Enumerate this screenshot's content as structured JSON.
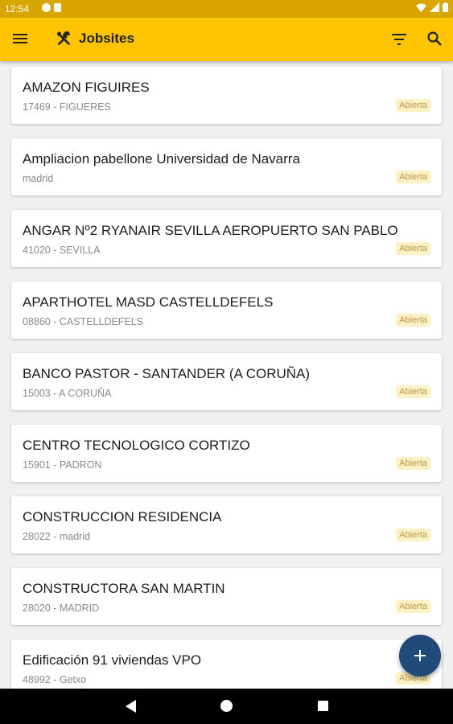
{
  "status_bar": {
    "time": "12:54"
  },
  "app_bar": {
    "title": "Jobsites",
    "accent_color": "#ffc400",
    "icons": [
      "menu-icon",
      "tools-icon",
      "filter-icon",
      "search-icon"
    ]
  },
  "jobsites": [
    {
      "name": "AMAZON FIGUIRES",
      "location": "17469 - FIGUERES",
      "status": "Abierta"
    },
    {
      "name": "Ampliacion pabellone Universidad de Navarra",
      "location": "madrid",
      "status": "Abierta"
    },
    {
      "name": "ANGAR Nº2 RYANAIR SEVILLA AEROPUERTO SAN PABLO",
      "location": "41020 - SEVILLA",
      "status": "Abierta"
    },
    {
      "name": "APARTHOTEL MASD CASTELLDEFELS",
      "location": "08860 - CASTELLDEFELS",
      "status": "Abierta"
    },
    {
      "name": "BANCO PASTOR - SANTANDER (A CORUÑA)",
      "location": "15003 - A CORUÑA",
      "status": "Abierta"
    },
    {
      "name": "CENTRO TECNOLOGICO CORTIZO",
      "location": "15901 - PADRON",
      "status": "Abierta"
    },
    {
      "name": "CONSTRUCCION RESIDENCIA",
      "location": "28022 - madrid",
      "status": "Abierta"
    },
    {
      "name": "CONSTRUCTORA SAN MARTIN",
      "location": "28020 - MADRID",
      "status": "Abierta"
    },
    {
      "name": "Edificación 91 viviendas VPO",
      "location": "48992 - Getxo",
      "status": "Abierta"
    }
  ],
  "fab": {
    "icon": "plus-icon",
    "color": "#1f4a79"
  }
}
